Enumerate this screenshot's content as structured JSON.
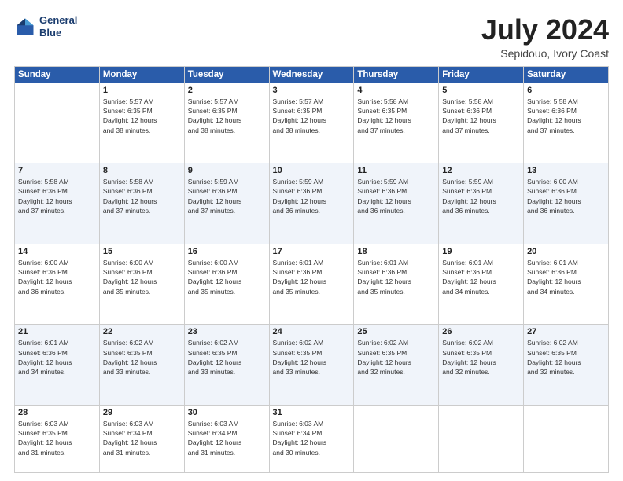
{
  "header": {
    "logo_line1": "General",
    "logo_line2": "Blue",
    "month": "July 2024",
    "location": "Sepidouo, Ivory Coast"
  },
  "days_of_week": [
    "Sunday",
    "Monday",
    "Tuesday",
    "Wednesday",
    "Thursday",
    "Friday",
    "Saturday"
  ],
  "weeks": [
    [
      {
        "day": "",
        "info": ""
      },
      {
        "day": "1",
        "info": "Sunrise: 5:57 AM\nSunset: 6:35 PM\nDaylight: 12 hours\nand 38 minutes."
      },
      {
        "day": "2",
        "info": "Sunrise: 5:57 AM\nSunset: 6:35 PM\nDaylight: 12 hours\nand 38 minutes."
      },
      {
        "day": "3",
        "info": "Sunrise: 5:57 AM\nSunset: 6:35 PM\nDaylight: 12 hours\nand 38 minutes."
      },
      {
        "day": "4",
        "info": "Sunrise: 5:58 AM\nSunset: 6:35 PM\nDaylight: 12 hours\nand 37 minutes."
      },
      {
        "day": "5",
        "info": "Sunrise: 5:58 AM\nSunset: 6:36 PM\nDaylight: 12 hours\nand 37 minutes."
      },
      {
        "day": "6",
        "info": "Sunrise: 5:58 AM\nSunset: 6:36 PM\nDaylight: 12 hours\nand 37 minutes."
      }
    ],
    [
      {
        "day": "7",
        "info": "Sunrise: 5:58 AM\nSunset: 6:36 PM\nDaylight: 12 hours\nand 37 minutes."
      },
      {
        "day": "8",
        "info": "Sunrise: 5:58 AM\nSunset: 6:36 PM\nDaylight: 12 hours\nand 37 minutes."
      },
      {
        "day": "9",
        "info": "Sunrise: 5:59 AM\nSunset: 6:36 PM\nDaylight: 12 hours\nand 37 minutes."
      },
      {
        "day": "10",
        "info": "Sunrise: 5:59 AM\nSunset: 6:36 PM\nDaylight: 12 hours\nand 36 minutes."
      },
      {
        "day": "11",
        "info": "Sunrise: 5:59 AM\nSunset: 6:36 PM\nDaylight: 12 hours\nand 36 minutes."
      },
      {
        "day": "12",
        "info": "Sunrise: 5:59 AM\nSunset: 6:36 PM\nDaylight: 12 hours\nand 36 minutes."
      },
      {
        "day": "13",
        "info": "Sunrise: 6:00 AM\nSunset: 6:36 PM\nDaylight: 12 hours\nand 36 minutes."
      }
    ],
    [
      {
        "day": "14",
        "info": "Sunrise: 6:00 AM\nSunset: 6:36 PM\nDaylight: 12 hours\nand 36 minutes."
      },
      {
        "day": "15",
        "info": "Sunrise: 6:00 AM\nSunset: 6:36 PM\nDaylight: 12 hours\nand 35 minutes."
      },
      {
        "day": "16",
        "info": "Sunrise: 6:00 AM\nSunset: 6:36 PM\nDaylight: 12 hours\nand 35 minutes."
      },
      {
        "day": "17",
        "info": "Sunrise: 6:01 AM\nSunset: 6:36 PM\nDaylight: 12 hours\nand 35 minutes."
      },
      {
        "day": "18",
        "info": "Sunrise: 6:01 AM\nSunset: 6:36 PM\nDaylight: 12 hours\nand 35 minutes."
      },
      {
        "day": "19",
        "info": "Sunrise: 6:01 AM\nSunset: 6:36 PM\nDaylight: 12 hours\nand 34 minutes."
      },
      {
        "day": "20",
        "info": "Sunrise: 6:01 AM\nSunset: 6:36 PM\nDaylight: 12 hours\nand 34 minutes."
      }
    ],
    [
      {
        "day": "21",
        "info": "Sunrise: 6:01 AM\nSunset: 6:36 PM\nDaylight: 12 hours\nand 34 minutes."
      },
      {
        "day": "22",
        "info": "Sunrise: 6:02 AM\nSunset: 6:35 PM\nDaylight: 12 hours\nand 33 minutes."
      },
      {
        "day": "23",
        "info": "Sunrise: 6:02 AM\nSunset: 6:35 PM\nDaylight: 12 hours\nand 33 minutes."
      },
      {
        "day": "24",
        "info": "Sunrise: 6:02 AM\nSunset: 6:35 PM\nDaylight: 12 hours\nand 33 minutes."
      },
      {
        "day": "25",
        "info": "Sunrise: 6:02 AM\nSunset: 6:35 PM\nDaylight: 12 hours\nand 32 minutes."
      },
      {
        "day": "26",
        "info": "Sunrise: 6:02 AM\nSunset: 6:35 PM\nDaylight: 12 hours\nand 32 minutes."
      },
      {
        "day": "27",
        "info": "Sunrise: 6:02 AM\nSunset: 6:35 PM\nDaylight: 12 hours\nand 32 minutes."
      }
    ],
    [
      {
        "day": "28",
        "info": "Sunrise: 6:03 AM\nSunset: 6:35 PM\nDaylight: 12 hours\nand 31 minutes."
      },
      {
        "day": "29",
        "info": "Sunrise: 6:03 AM\nSunset: 6:34 PM\nDaylight: 12 hours\nand 31 minutes."
      },
      {
        "day": "30",
        "info": "Sunrise: 6:03 AM\nSunset: 6:34 PM\nDaylight: 12 hours\nand 31 minutes."
      },
      {
        "day": "31",
        "info": "Sunrise: 6:03 AM\nSunset: 6:34 PM\nDaylight: 12 hours\nand 30 minutes."
      },
      {
        "day": "",
        "info": ""
      },
      {
        "day": "",
        "info": ""
      },
      {
        "day": "",
        "info": ""
      }
    ]
  ]
}
